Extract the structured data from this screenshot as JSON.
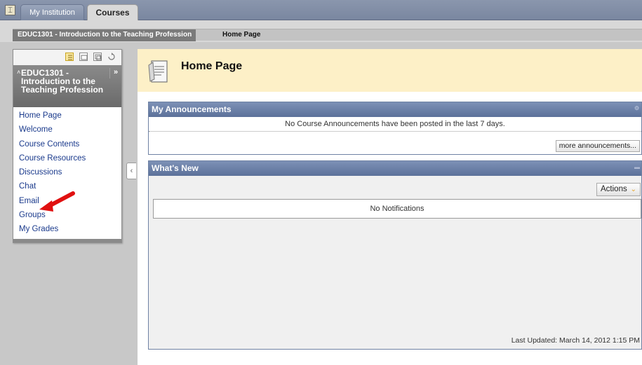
{
  "topbar": {
    "brand_icon": "institution-icon",
    "tabs": [
      {
        "label": "My Institution",
        "active": false
      },
      {
        "label": "Courses",
        "active": true
      }
    ]
  },
  "breadcrumb": {
    "course": "EDUC1301 - Introduction to the Teaching Profession",
    "current": "Home Page"
  },
  "course_menu": {
    "tool_icons": [
      "list-view-icon",
      "folder-view-icon",
      "window-icon",
      "refresh-icon"
    ],
    "title": "EDUC1301 - Introduction to the Teaching Profession",
    "expand_label": "»",
    "items": [
      {
        "label": "Home Page"
      },
      {
        "label": "Welcome"
      },
      {
        "label": "Course Contents"
      },
      {
        "label": "Course Resources"
      },
      {
        "label": "Discussions"
      },
      {
        "label": "Chat"
      },
      {
        "label": "Email"
      },
      {
        "label": "Groups"
      },
      {
        "label": "My Grades"
      }
    ]
  },
  "page": {
    "title": "Home Page",
    "accent": "#fdf0c7"
  },
  "announcements": {
    "title": "My Announcements",
    "message": "No Course Announcements have been posted in the last 7 days.",
    "more_button": "more announcements..."
  },
  "whats_new": {
    "title": "What's New",
    "actions_button": "Actions",
    "notification": "No Notifications",
    "last_updated": "Last Updated: March 14, 2012 1:15 PM"
  },
  "colors": {
    "module_header": "#6b7fa5",
    "link": "#1a3a8c",
    "annotation_arrow": "#e01010"
  }
}
